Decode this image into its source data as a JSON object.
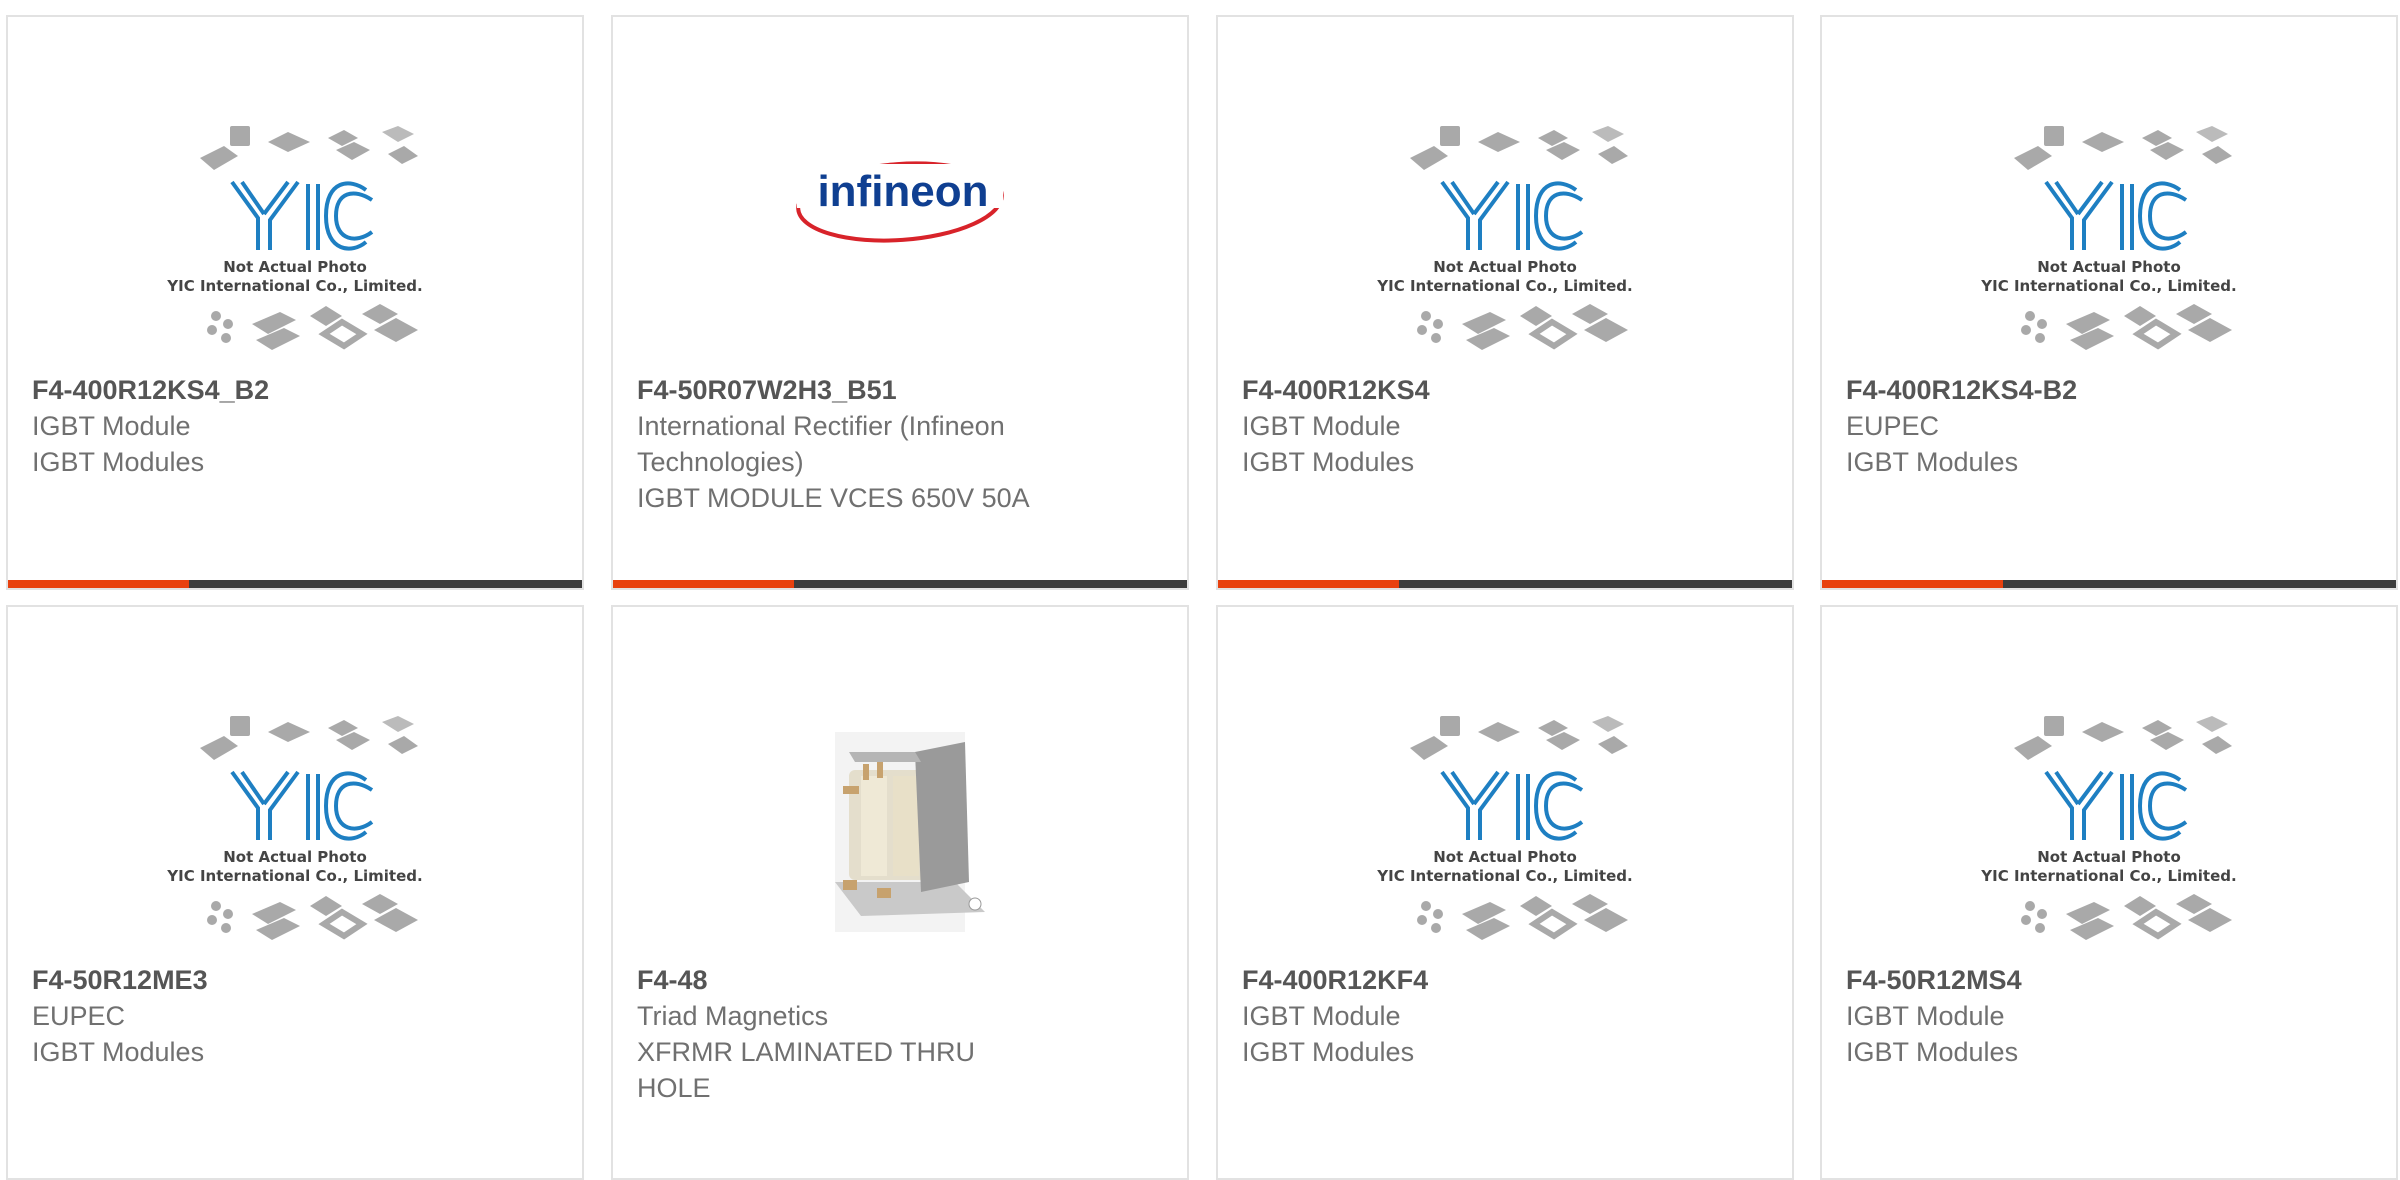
{
  "placeholder": {
    "logo": "YIC",
    "caption_line1": "Not Actual Photo",
    "caption_line2": "YIC International Co., Limited."
  },
  "brand_logo_text": "infineon",
  "colors": {
    "accent": "#e8410e",
    "bar": "#3c3c3c",
    "yic_blue": "#1e7fc2",
    "infineon_blue": "#0f3f91",
    "infineon_red": "#d8232a"
  },
  "products": [
    {
      "part": "F4-400R12KS4_B2",
      "lines": [
        "IGBT Module",
        "IGBT Modules"
      ],
      "image": "yic-placeholder",
      "has_bar": true
    },
    {
      "part": "F4-50R07W2H3_B51",
      "lines": [
        "International Rectifier (Infineon",
        "Technologies)",
        "IGBT MODULE VCES 650V 50A"
      ],
      "image": "infineon-logo",
      "has_bar": true
    },
    {
      "part": "F4-400R12KS4",
      "lines": [
        "IGBT Module",
        "IGBT Modules"
      ],
      "image": "yic-placeholder",
      "has_bar": true
    },
    {
      "part": "F4-400R12KS4-B2",
      "lines": [
        "EUPEC",
        "IGBT Modules"
      ],
      "image": "yic-placeholder",
      "has_bar": true
    },
    {
      "part": "F4-50R12ME3",
      "lines": [
        "EUPEC",
        "IGBT Modules"
      ],
      "image": "yic-placeholder",
      "has_bar": false
    },
    {
      "part": "F4-48",
      "lines": [
        "Triad Magnetics",
        "XFRMR LAMINATED THRU",
        "HOLE"
      ],
      "image": "transformer-photo",
      "has_bar": false
    },
    {
      "part": "F4-400R12KF4",
      "lines": [
        "IGBT Module",
        "IGBT Modules"
      ],
      "image": "yic-placeholder",
      "has_bar": false
    },
    {
      "part": "F4-50R12MS4",
      "lines": [
        "IGBT Module",
        "IGBT Modules"
      ],
      "image": "yic-placeholder",
      "has_bar": false
    }
  ]
}
